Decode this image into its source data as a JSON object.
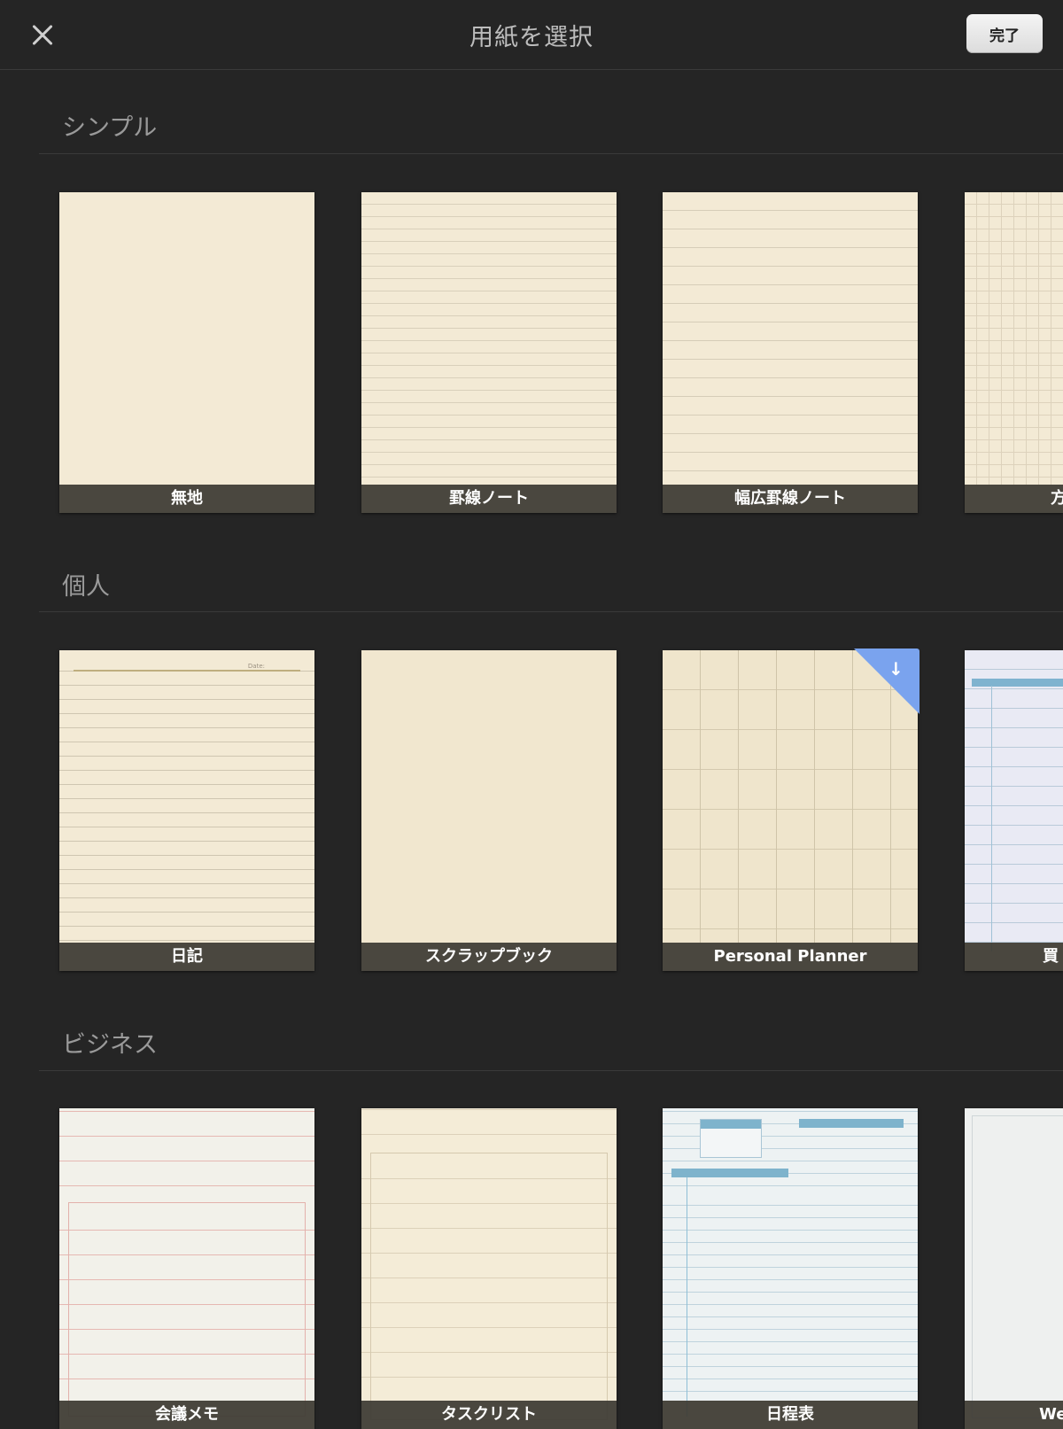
{
  "header": {
    "title": "用紙を選択",
    "done_label": "完了"
  },
  "sections": [
    {
      "title": "シンプル",
      "items": [
        {
          "label": "無地",
          "style": "plain"
        },
        {
          "label": "罫線ノート",
          "style": "lined"
        },
        {
          "label": "幅広罫線ノート",
          "style": "wide"
        },
        {
          "label": "方",
          "style": "grid"
        }
      ]
    },
    {
      "title": "個人",
      "items": [
        {
          "label": "日記",
          "style": "diary"
        },
        {
          "label": "スクラップブック",
          "style": "scrap"
        },
        {
          "label": "Personal Planner",
          "style": "planner",
          "badge": "download-icon"
        },
        {
          "label": "買",
          "style": "shop"
        }
      ]
    },
    {
      "title": "ビジネス",
      "items": [
        {
          "label": "会議メモ",
          "style": "meeting"
        },
        {
          "label": "タスクリスト",
          "style": "task"
        },
        {
          "label": "日程表",
          "style": "sched"
        },
        {
          "label": "We",
          "style": "week"
        }
      ]
    }
  ],
  "colors": {
    "background": "#252525",
    "paper": "#f3ead5",
    "badge": "#7aa3ee"
  }
}
